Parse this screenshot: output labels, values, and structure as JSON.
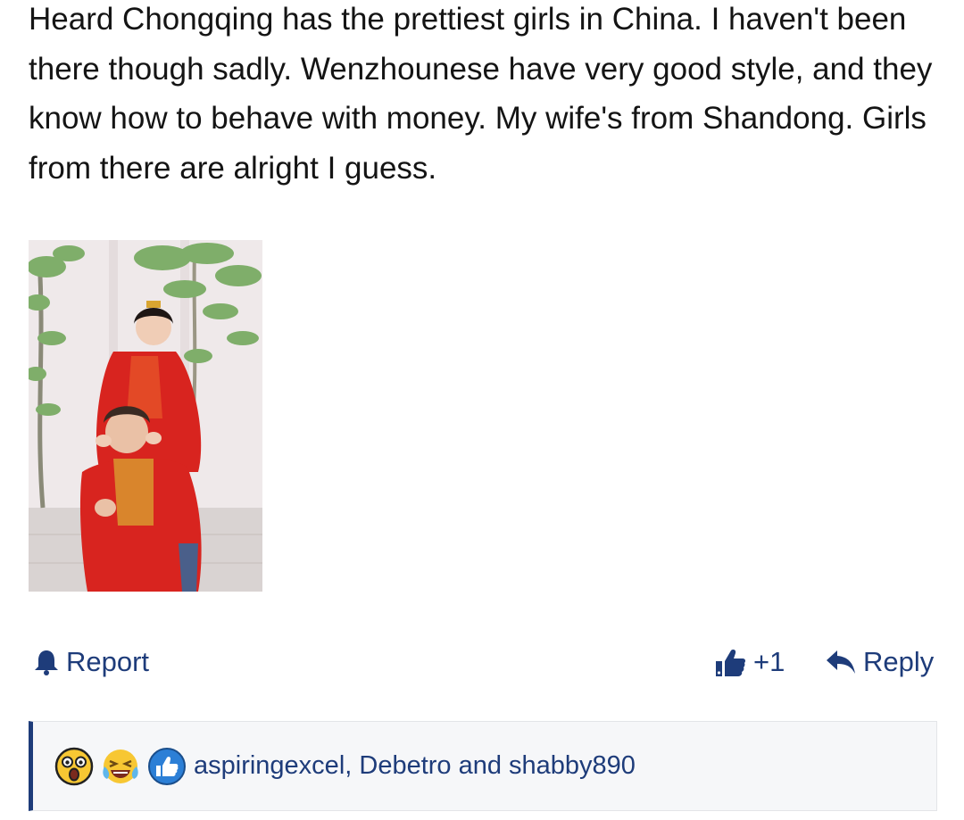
{
  "post": {
    "body": "Heard Chongqing has the prettiest girls in China. I haven't been there though sadly. Wenzhounese have very good style, and they know how to behave with money. My wife's from Shandong. Girls from there are alright I guess."
  },
  "image": {
    "content": "photo-wedding-couple-red-traditional-dress"
  },
  "actions": {
    "report_label": "Report",
    "report_icon": "bell-icon",
    "like_icon": "thumbs-up-icon",
    "like_count": "+1",
    "reply_label": "Reply",
    "reply_icon": "reply-arrow-icon"
  },
  "reactions": {
    "emojis": [
      "astonished-face-icon",
      "crying-laughing-face-icon",
      "thumbs-up-like-icon"
    ],
    "reacted_by": "aspiringexcel, Debetro and shabby890"
  },
  "colors": {
    "text": "#141414",
    "link": "#1e3c7a",
    "accent_bar": "#1e3c7a",
    "panel_bg": "#f6f7f9"
  }
}
